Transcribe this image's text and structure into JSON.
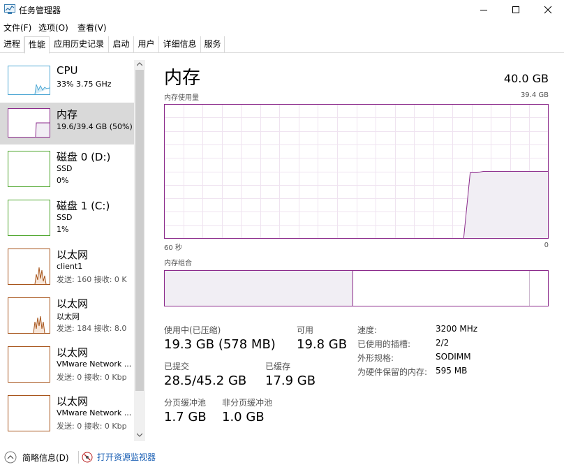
{
  "window": {
    "title": "任务管理器",
    "app_icon": "task-manager-icon",
    "controls": [
      "minimize-icon",
      "maximize-icon",
      "close-icon"
    ]
  },
  "menu": {
    "file": "文件(F)",
    "options": "选项(O)",
    "view": "查看(V)"
  },
  "tabs": [
    {
      "label": "进程",
      "active": false
    },
    {
      "label": "性能",
      "active": true
    },
    {
      "label": "应用历史记录",
      "active": false
    },
    {
      "label": "启动",
      "active": false
    },
    {
      "label": "用户",
      "active": false
    },
    {
      "label": "详细信息",
      "active": false
    },
    {
      "label": "服务",
      "active": false
    }
  ],
  "sidebar": {
    "items": [
      {
        "name": "CPU",
        "line1": "33%  3.75 GHz",
        "line2": "",
        "color": "#4fa8d4",
        "selected": false
      },
      {
        "name": "内存",
        "line1": "19.6/39.4 GB (50%)",
        "line2": "",
        "color": "#8b2a8b",
        "selected": true
      },
      {
        "name": "磁盘 0 (D:)",
        "line1": "SSD",
        "line2": "0%",
        "color": "#4ca52a",
        "selected": false
      },
      {
        "name": "磁盘 1 (C:)",
        "line1": "SSD",
        "line2": "1%",
        "color": "#4ca52a",
        "selected": false
      },
      {
        "name": "以太网",
        "line1": "client1",
        "line2": "发送: 160  接收: 0 K",
        "color": "#a7541a",
        "selected": false
      },
      {
        "name": "以太网",
        "line1": "以太网",
        "line2": "发送: 184  接收: 8.0",
        "color": "#a7541a",
        "selected": false
      },
      {
        "name": "以太网",
        "line1": "VMware Network ...",
        "line2": "发送: 0  接收: 0 Kbp",
        "color": "#a7541a",
        "selected": false
      },
      {
        "name": "以太网",
        "line1": "VMware Network ...",
        "line2": "发送: 0  接收: 0 Kbp",
        "color": "#a7541a",
        "selected": false
      }
    ]
  },
  "main": {
    "heading": "内存",
    "total": "40.0 GB",
    "usage_label": "内存使用量",
    "usage_max": "39.4 GB",
    "time_left": "60 秒",
    "time_right": "0",
    "composition_label": "内存组合",
    "usage_chart": {
      "history": [
        0,
        0,
        0,
        0,
        0,
        0,
        0,
        0,
        0,
        0,
        0,
        0,
        0,
        0,
        0,
        0,
        0,
        0,
        0,
        0,
        0,
        0,
        0,
        0,
        0,
        0,
        0,
        0,
        0,
        0,
        0,
        0,
        0,
        0,
        0,
        0,
        0,
        0,
        0,
        0,
        0,
        0,
        0,
        0,
        0,
        0,
        0,
        0.49,
        0.49,
        0.5,
        0.5,
        0.5,
        0.5,
        0.5,
        0.5,
        0.5,
        0.5,
        0.5,
        0.5,
        0.5
      ]
    },
    "composition": {
      "in_use_fraction": 0.49,
      "standby_end_fraction": 0.95
    },
    "stats": {
      "in_use_label": "使用中(已压缩)",
      "in_use_value": "19.3 GB (578 MB)",
      "available_label": "可用",
      "available_value": "19.8 GB",
      "committed_label": "已提交",
      "committed_value": "28.5/45.2 GB",
      "cached_label": "已缓存",
      "cached_value": "17.9 GB",
      "paged_label": "分页缓冲池",
      "paged_value": "1.7 GB",
      "nonpaged_label": "非分页缓冲池",
      "nonpaged_value": "1.0 GB"
    },
    "details": {
      "speed_label": "速度:",
      "speed_value": "3200 MHz",
      "slots_label": "已使用的插槽:",
      "slots_value": "2/2",
      "form_label": "外形规格:",
      "form_value": "SODIMM",
      "reserved_label": "为硬件保留的内存:",
      "reserved_value": "595 MB"
    }
  },
  "footer": {
    "summary": "简略信息(D)",
    "resmon": "打开资源监视器"
  }
}
